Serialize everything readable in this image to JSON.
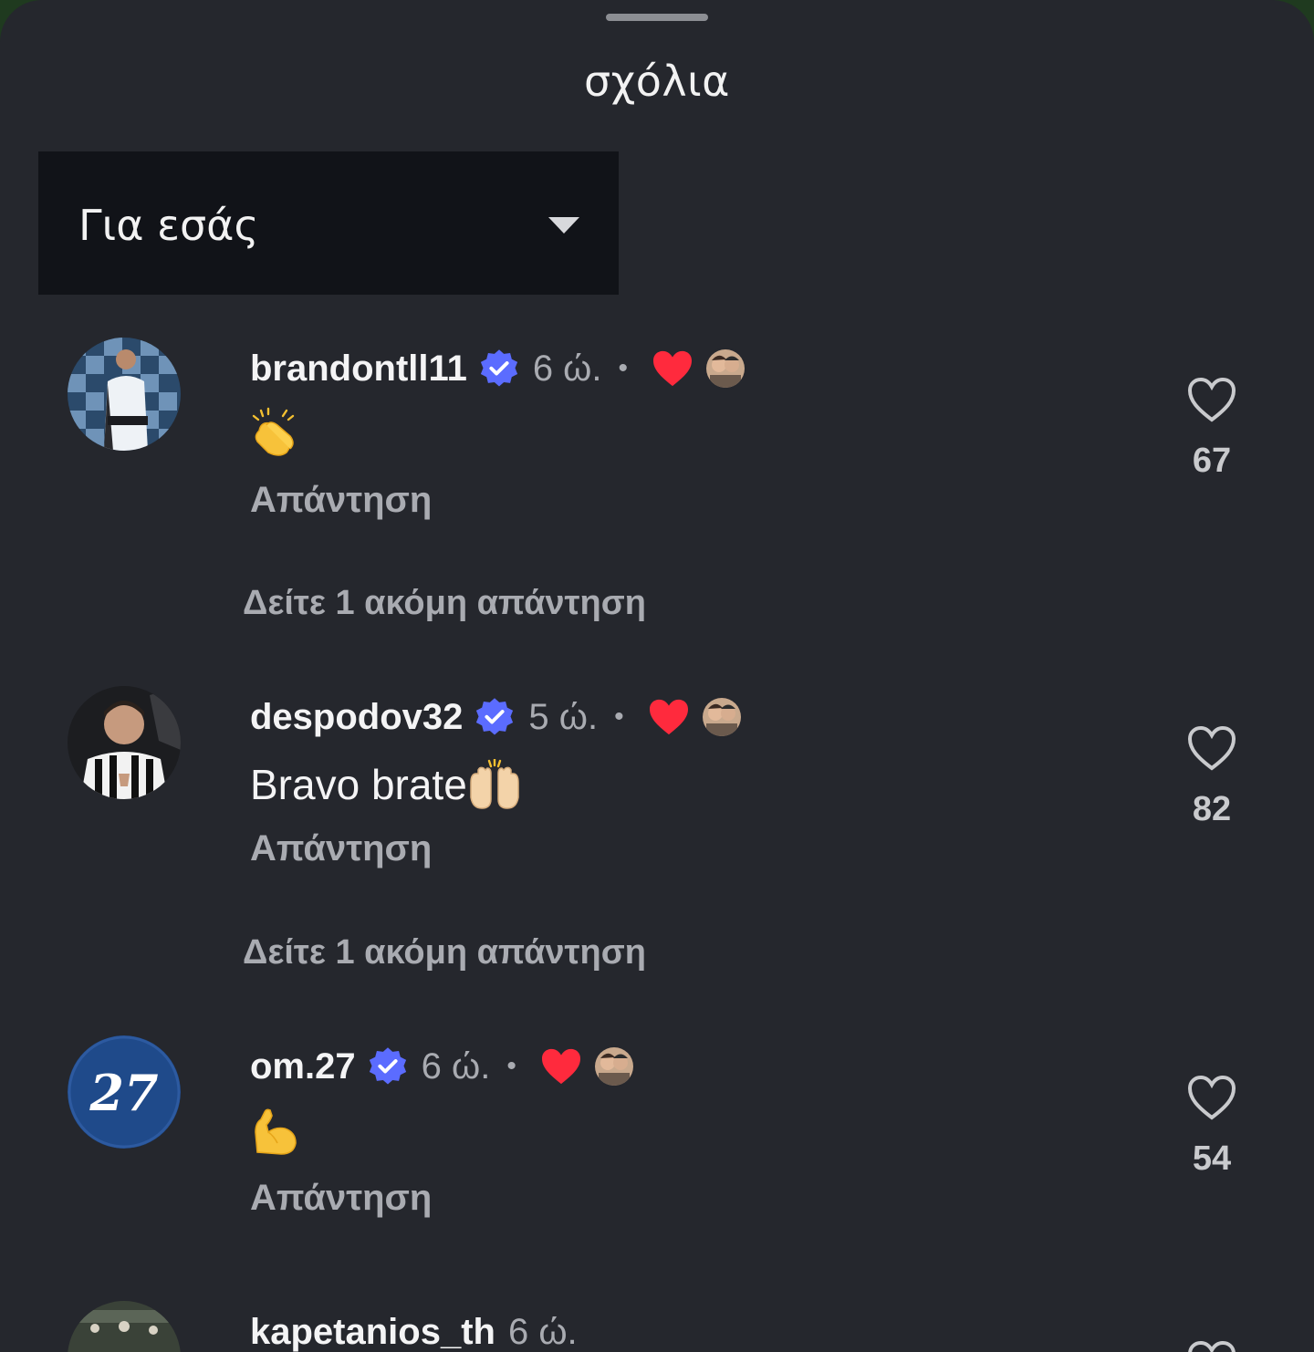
{
  "sheet": {
    "title": "σχόλια"
  },
  "sort": {
    "selected": "Για εσάς"
  },
  "comments": [
    {
      "username": "brandontll11",
      "time": "6 ώ.",
      "separator": "•",
      "text": "",
      "emoji": "clapping-hands",
      "reply_label": "Απάντηση",
      "likes": "67",
      "more_replies": "Δείτε 1 ακόμη απάντηση"
    },
    {
      "username": "despodov32",
      "time": "5 ώ.",
      "separator": "•",
      "text": "Bravo brate",
      "emoji": "raising-hands",
      "reply_label": "Απάντηση",
      "likes": "82",
      "more_replies": "Δείτε 1 ακόμη απάντηση"
    },
    {
      "username": "om.27",
      "time": "6 ώ.",
      "separator": "•",
      "text": "",
      "emoji": "flexed-biceps",
      "reply_label": "Απάντηση",
      "likes": "54",
      "avatar_text": "27"
    },
    {
      "username": "kapetanios_th",
      "time": "6 ώ."
    }
  ],
  "colors": {
    "background": "#25272d",
    "verified": "#5b6cff",
    "liked_heart": "#ff2a3d",
    "text_primary": "#f4f4f5",
    "text_secondary": "#a9abb1"
  }
}
